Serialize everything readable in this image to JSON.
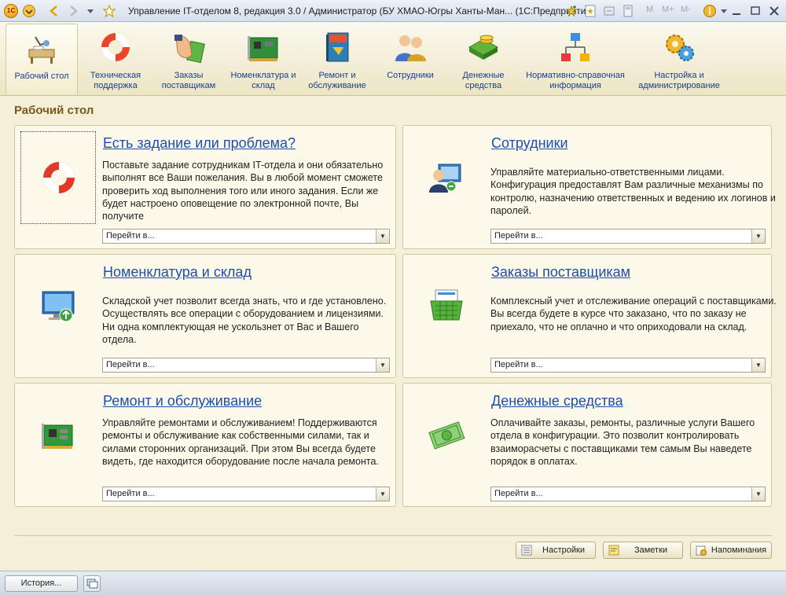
{
  "window": {
    "title": "Управление IT-отделом 8, редакция 3.0 / Администратор (БУ ХМАО-Югры Ханты-Ман... (1С:Предприятие)",
    "m_labels": [
      "M",
      "M+",
      "M-"
    ]
  },
  "sections": [
    {
      "label": "Рабочий стол",
      "icon": "desk-icon"
    },
    {
      "label": "Техническая поддержка",
      "icon": "lifebuoy-icon"
    },
    {
      "label": "Заказы поставщикам",
      "icon": "hand-money-icon"
    },
    {
      "label": "Номенклатура и склад",
      "icon": "board-icon"
    },
    {
      "label": "Ремонт и обслуживание",
      "icon": "book-icon"
    },
    {
      "label": "Сотрудники",
      "icon": "people-icon"
    },
    {
      "label": "Денежные средства",
      "icon": "coins-icon"
    },
    {
      "label": "Нормативно-справочная информация",
      "icon": "hierarchy-icon"
    },
    {
      "label": "Настройка и администрирование",
      "icon": "gears-icon"
    }
  ],
  "page_title": "Рабочий стол",
  "cards": [
    {
      "title": "Есть задание или проблема?",
      "desc": "Поставьте задание сотрудникам IT-отдела и они обязательно выполнят все Ваши пожелания. Вы в любой момент сможете проверить ход выполнения того или иного задания. Если же будет настроено оповещение по электронной почте, Вы получите",
      "goto": "Перейти в...",
      "icon": "lifebuoy-icon"
    },
    {
      "title": "Сотрудники",
      "desc": "Управляйте материально-ответственными лицами. Конфигурация предоставлят Вам различные механизмы по контролю, назначению ответственных и ведению их логинов и паролей.",
      "goto": "Перейти в...",
      "icon": "user-computer-icon"
    },
    {
      "title": "Номенклатура и склад",
      "desc": "Складской учет позволит всегда знать, что и где установлено. Осуществлять все операции с оборудованием и лицензиями. Ни одна комплектующая не ускользнет от Вас и Вашего отдела.",
      "goto": "Перейти в...",
      "icon": "monitor-icon"
    },
    {
      "title": "Заказы поставщикам",
      "desc": "Комплексный учет и отслеживание операций с поставщиками. Вы всегда будете в курсе что заказано, что по заказу не приехало, что не оплачно и что оприходовали на склад.",
      "goto": "Перейти в...",
      "icon": "basket-icon"
    },
    {
      "title": "Ремонт и обслуживание",
      "desc": "Управляйте ремонтами и обслуживанием! Поддерживаются ремонты и обслуживание как собственными силами, так и силами сторонних организаций. При этом Вы всегда будете видеть, где находится оборудование после начала ремонта.",
      "goto": "Перейти в...",
      "icon": "circuit-board-icon"
    },
    {
      "title": "Денежные средства",
      "desc": "Оплачивайте заказы, ремонты, различные услуги Вашего отдела в конфигурации. Это позволит контролировать взаиморасчеты с поставщиками тем самым Вы наведете порядок в оплатах.",
      "goto": "Перейти в...",
      "icon": "money-icon"
    }
  ],
  "footer": {
    "settings": "Настройки",
    "notes": "Заметки",
    "reminders": "Напоминания"
  },
  "status": {
    "history": "История..."
  }
}
